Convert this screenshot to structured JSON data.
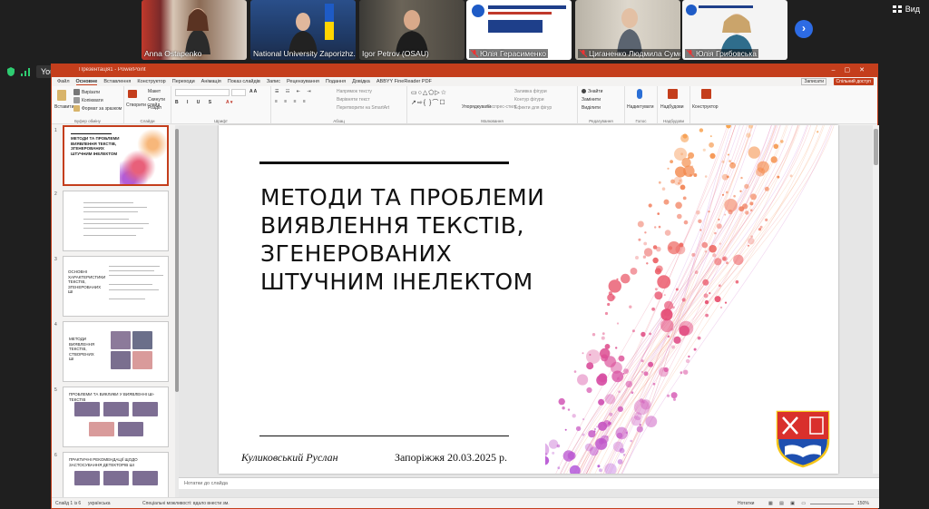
{
  "participants": [
    {
      "name": "Anna Ostapenko",
      "muted": false
    },
    {
      "name": "National University Zaporizhz...",
      "muted": false
    },
    {
      "name": "Igor Petrov (OSAU)",
      "muted": false
    },
    {
      "name": "Юлія Герасименко",
      "muted": true
    },
    {
      "name": "Циганенко Людмила Сумс...",
      "muted": true
    },
    {
      "name": "Юлія Грибовська",
      "muted": true
    }
  ],
  "view_label": "Вид",
  "share_badge": "YouTube",
  "ppt": {
    "title": "Презентація1 - PowerPoint",
    "menu": [
      "Файл",
      "Основне",
      "Вставлення",
      "Конструктор",
      "Переходи",
      "Анімація",
      "Показ слайдів",
      "Запис",
      "Рецензування",
      "Подання",
      "Довідка",
      "ABBYY FineReader PDF"
    ],
    "active_menu": "Основне",
    "comments_label": "Записати",
    "share_label": "Спільний доступ",
    "ribbon_groups": [
      {
        "label": "Буфер обміну",
        "items": [
          "Вставити",
          "Вирізати",
          "Копіювати",
          "Формат за зразком"
        ]
      },
      {
        "label": "Слайди",
        "items": [
          "Створити слайд",
          "Макет",
          "Скинути",
          "Розділ"
        ]
      },
      {
        "label": "Шрифт",
        "items": []
      },
      {
        "label": "Абзац",
        "items": [
          "Напрямок тексту",
          "Вирівняти текст",
          "Перетворити на SmartArt"
        ]
      },
      {
        "label": "Малювання",
        "items": [
          "Упорядкувати",
          "Експрес-стилі",
          "Заливка фігури",
          "Контур фігури",
          "Ефекти для фігур"
        ]
      },
      {
        "label": "Редагування",
        "items": [
          "Знайти",
          "Замінити",
          "Виділити"
        ]
      },
      {
        "label": "Голос",
        "items": [
          "Надиктувати"
        ]
      },
      {
        "label": "Надбудови",
        "items": [
          "Надбудови"
        ]
      },
      {
        "label": "",
        "items": [
          "Конструктор"
        ]
      }
    ],
    "slide_numbers": [
      "1",
      "2",
      "3",
      "4",
      "5",
      "6"
    ],
    "thumbs": {
      "t1": "Методи та проблеми виявлення текстів, згенерованих штучним інелектом",
      "t3": "Основні характеристики текстів, згенерованих ШІ",
      "t4": "Методи виявлення текстів, створених ШІ",
      "t5": "Проблеми та виклики у виявленні ШІ-текстів",
      "t6": "Практичні рекомендації щодо застосування детекторів ШІ"
    },
    "slide": {
      "title": "Методи та проблеми виявлення текстів, згенерованих штучним інелектом",
      "author": "Куликовський Руслан",
      "city_date": "Запоріжжя 20.03.2025 р."
    },
    "notes_placeholder": "Нотатки до слайда",
    "status": {
      "slide_count": "Слайд 1 із 6",
      "language": "українська",
      "accessibility": "Спеціальні можливості: вдало внести зм.",
      "notes_btn": "Нотатки",
      "zoom": "150%"
    }
  },
  "colors": {
    "ppt_accent": "#c43e1c",
    "zoom_blue": "#2d6be4"
  }
}
